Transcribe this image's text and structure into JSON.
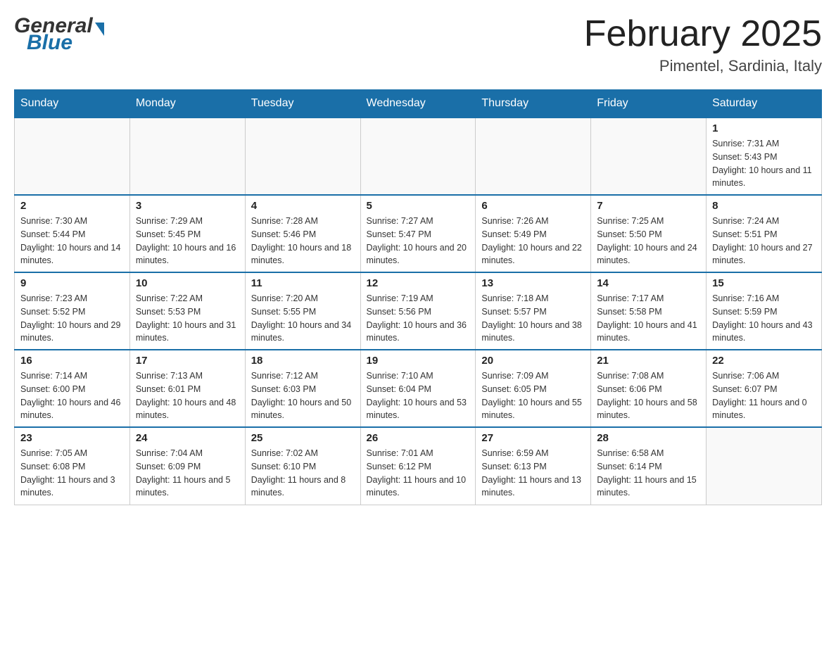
{
  "header": {
    "logo_general": "General",
    "logo_blue": "Blue",
    "month_title": "February 2025",
    "location": "Pimentel, Sardinia, Italy"
  },
  "days_of_week": [
    "Sunday",
    "Monday",
    "Tuesday",
    "Wednesday",
    "Thursday",
    "Friday",
    "Saturday"
  ],
  "weeks": [
    [
      {
        "day": "",
        "sunrise": "",
        "sunset": "",
        "daylight": "",
        "empty": true
      },
      {
        "day": "",
        "sunrise": "",
        "sunset": "",
        "daylight": "",
        "empty": true
      },
      {
        "day": "",
        "sunrise": "",
        "sunset": "",
        "daylight": "",
        "empty": true
      },
      {
        "day": "",
        "sunrise": "",
        "sunset": "",
        "daylight": "",
        "empty": true
      },
      {
        "day": "",
        "sunrise": "",
        "sunset": "",
        "daylight": "",
        "empty": true
      },
      {
        "day": "",
        "sunrise": "",
        "sunset": "",
        "daylight": "",
        "empty": true
      },
      {
        "day": "1",
        "sunrise": "Sunrise: 7:31 AM",
        "sunset": "Sunset: 5:43 PM",
        "daylight": "Daylight: 10 hours and 11 minutes.",
        "empty": false
      }
    ],
    [
      {
        "day": "2",
        "sunrise": "Sunrise: 7:30 AM",
        "sunset": "Sunset: 5:44 PM",
        "daylight": "Daylight: 10 hours and 14 minutes.",
        "empty": false
      },
      {
        "day": "3",
        "sunrise": "Sunrise: 7:29 AM",
        "sunset": "Sunset: 5:45 PM",
        "daylight": "Daylight: 10 hours and 16 minutes.",
        "empty": false
      },
      {
        "day": "4",
        "sunrise": "Sunrise: 7:28 AM",
        "sunset": "Sunset: 5:46 PM",
        "daylight": "Daylight: 10 hours and 18 minutes.",
        "empty": false
      },
      {
        "day": "5",
        "sunrise": "Sunrise: 7:27 AM",
        "sunset": "Sunset: 5:47 PM",
        "daylight": "Daylight: 10 hours and 20 minutes.",
        "empty": false
      },
      {
        "day": "6",
        "sunrise": "Sunrise: 7:26 AM",
        "sunset": "Sunset: 5:49 PM",
        "daylight": "Daylight: 10 hours and 22 minutes.",
        "empty": false
      },
      {
        "day": "7",
        "sunrise": "Sunrise: 7:25 AM",
        "sunset": "Sunset: 5:50 PM",
        "daylight": "Daylight: 10 hours and 24 minutes.",
        "empty": false
      },
      {
        "day": "8",
        "sunrise": "Sunrise: 7:24 AM",
        "sunset": "Sunset: 5:51 PM",
        "daylight": "Daylight: 10 hours and 27 minutes.",
        "empty": false
      }
    ],
    [
      {
        "day": "9",
        "sunrise": "Sunrise: 7:23 AM",
        "sunset": "Sunset: 5:52 PM",
        "daylight": "Daylight: 10 hours and 29 minutes.",
        "empty": false
      },
      {
        "day": "10",
        "sunrise": "Sunrise: 7:22 AM",
        "sunset": "Sunset: 5:53 PM",
        "daylight": "Daylight: 10 hours and 31 minutes.",
        "empty": false
      },
      {
        "day": "11",
        "sunrise": "Sunrise: 7:20 AM",
        "sunset": "Sunset: 5:55 PM",
        "daylight": "Daylight: 10 hours and 34 minutes.",
        "empty": false
      },
      {
        "day": "12",
        "sunrise": "Sunrise: 7:19 AM",
        "sunset": "Sunset: 5:56 PM",
        "daylight": "Daylight: 10 hours and 36 minutes.",
        "empty": false
      },
      {
        "day": "13",
        "sunrise": "Sunrise: 7:18 AM",
        "sunset": "Sunset: 5:57 PM",
        "daylight": "Daylight: 10 hours and 38 minutes.",
        "empty": false
      },
      {
        "day": "14",
        "sunrise": "Sunrise: 7:17 AM",
        "sunset": "Sunset: 5:58 PM",
        "daylight": "Daylight: 10 hours and 41 minutes.",
        "empty": false
      },
      {
        "day": "15",
        "sunrise": "Sunrise: 7:16 AM",
        "sunset": "Sunset: 5:59 PM",
        "daylight": "Daylight: 10 hours and 43 minutes.",
        "empty": false
      }
    ],
    [
      {
        "day": "16",
        "sunrise": "Sunrise: 7:14 AM",
        "sunset": "Sunset: 6:00 PM",
        "daylight": "Daylight: 10 hours and 46 minutes.",
        "empty": false
      },
      {
        "day": "17",
        "sunrise": "Sunrise: 7:13 AM",
        "sunset": "Sunset: 6:01 PM",
        "daylight": "Daylight: 10 hours and 48 minutes.",
        "empty": false
      },
      {
        "day": "18",
        "sunrise": "Sunrise: 7:12 AM",
        "sunset": "Sunset: 6:03 PM",
        "daylight": "Daylight: 10 hours and 50 minutes.",
        "empty": false
      },
      {
        "day": "19",
        "sunrise": "Sunrise: 7:10 AM",
        "sunset": "Sunset: 6:04 PM",
        "daylight": "Daylight: 10 hours and 53 minutes.",
        "empty": false
      },
      {
        "day": "20",
        "sunrise": "Sunrise: 7:09 AM",
        "sunset": "Sunset: 6:05 PM",
        "daylight": "Daylight: 10 hours and 55 minutes.",
        "empty": false
      },
      {
        "day": "21",
        "sunrise": "Sunrise: 7:08 AM",
        "sunset": "Sunset: 6:06 PM",
        "daylight": "Daylight: 10 hours and 58 minutes.",
        "empty": false
      },
      {
        "day": "22",
        "sunrise": "Sunrise: 7:06 AM",
        "sunset": "Sunset: 6:07 PM",
        "daylight": "Daylight: 11 hours and 0 minutes.",
        "empty": false
      }
    ],
    [
      {
        "day": "23",
        "sunrise": "Sunrise: 7:05 AM",
        "sunset": "Sunset: 6:08 PM",
        "daylight": "Daylight: 11 hours and 3 minutes.",
        "empty": false
      },
      {
        "day": "24",
        "sunrise": "Sunrise: 7:04 AM",
        "sunset": "Sunset: 6:09 PM",
        "daylight": "Daylight: 11 hours and 5 minutes.",
        "empty": false
      },
      {
        "day": "25",
        "sunrise": "Sunrise: 7:02 AM",
        "sunset": "Sunset: 6:10 PM",
        "daylight": "Daylight: 11 hours and 8 minutes.",
        "empty": false
      },
      {
        "day": "26",
        "sunrise": "Sunrise: 7:01 AM",
        "sunset": "Sunset: 6:12 PM",
        "daylight": "Daylight: 11 hours and 10 minutes.",
        "empty": false
      },
      {
        "day": "27",
        "sunrise": "Sunrise: 6:59 AM",
        "sunset": "Sunset: 6:13 PM",
        "daylight": "Daylight: 11 hours and 13 minutes.",
        "empty": false
      },
      {
        "day": "28",
        "sunrise": "Sunrise: 6:58 AM",
        "sunset": "Sunset: 6:14 PM",
        "daylight": "Daylight: 11 hours and 15 minutes.",
        "empty": false
      },
      {
        "day": "",
        "sunrise": "",
        "sunset": "",
        "daylight": "",
        "empty": true
      }
    ]
  ]
}
